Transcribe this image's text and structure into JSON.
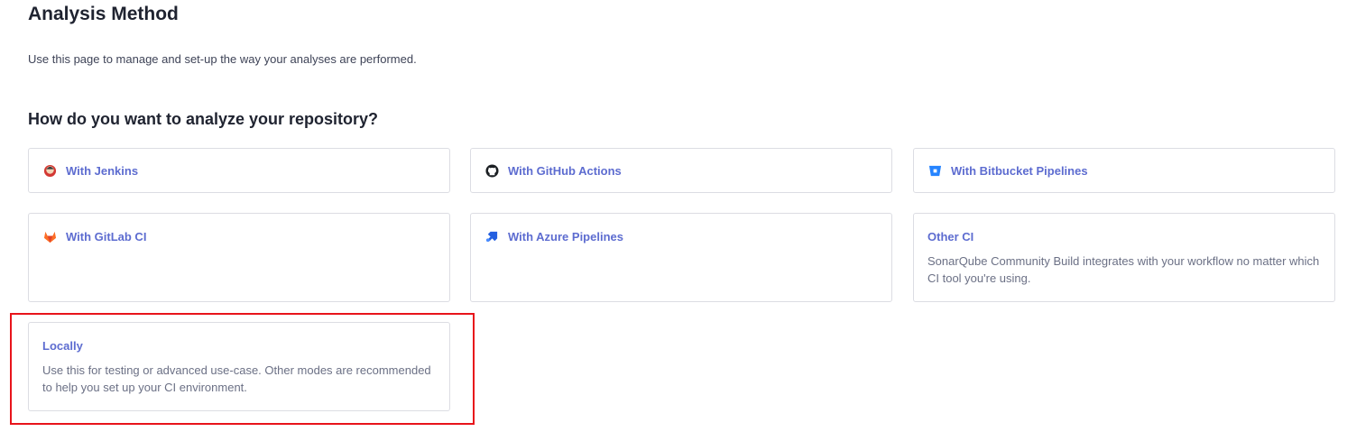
{
  "page": {
    "title": "Analysis Method",
    "description": "Use this page to manage and set-up the way your analyses are performed.",
    "question": "How do you want to analyze your repository?"
  },
  "options": [
    {
      "label": "With Jenkins",
      "icon": "jenkins-icon"
    },
    {
      "label": "With GitHub Actions",
      "icon": "github-icon"
    },
    {
      "label": "With Bitbucket Pipelines",
      "icon": "bitbucket-icon"
    },
    {
      "label": "With GitLab CI",
      "icon": "gitlab-icon"
    },
    {
      "label": "With Azure Pipelines",
      "icon": "azure-pipelines-icon"
    },
    {
      "label": "Other CI",
      "text": "SonarQube Community Build integrates with your workflow no matter which CI tool you're using."
    },
    {
      "label": "Locally",
      "text": "Use this for testing or advanced use-case. Other modes are recommended to help you set up your CI environment."
    }
  ],
  "colors": {
    "link": "#5d6cd0",
    "highlight": "#e8141b"
  }
}
